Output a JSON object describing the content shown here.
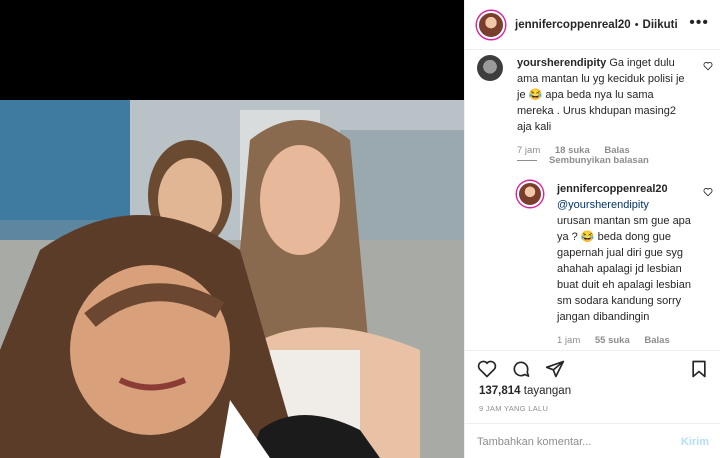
{
  "header": {
    "username": "jennifercoppenreal20",
    "separator": "•",
    "follow_status": "Diikuti",
    "more_label": "•••"
  },
  "comments": [
    {
      "username": "yoursherendipity",
      "text": "Ga inget dulu ama mantan lu yg keciduk polisi je je 😂 apa beda nya lu sama mereka . Urus khdupan masing2 aja kali",
      "time": "7 jam",
      "likes": "18 suka",
      "reply": "Balas"
    }
  ],
  "hide_replies": "Sembunyikan balasan",
  "reply": {
    "username": "jennifercoppenreal20",
    "mention": "@yoursherendipity",
    "text": "urusan mantan sm gue apa ya ? 😂 beda dong gue gapernah jual diri gue syg ahahah apalagi jd lesbian buat duit eh apalagi lesbian sm sodara kandung sorry jangan dibandingin",
    "time": "1 jam",
    "likes": "55 suka",
    "reply": "Balas"
  },
  "views": {
    "count": "137,814",
    "label": "tayangan"
  },
  "posted": "9 JAM YANG LALU",
  "add_comment": {
    "placeholder": "Tambahkan komentar...",
    "post_label": "Kirim"
  },
  "colors": {
    "link": "#00376b",
    "meta": "#8e8e8e",
    "post_disabled": "#b2dffc",
    "story_ring": "#d6249f"
  }
}
